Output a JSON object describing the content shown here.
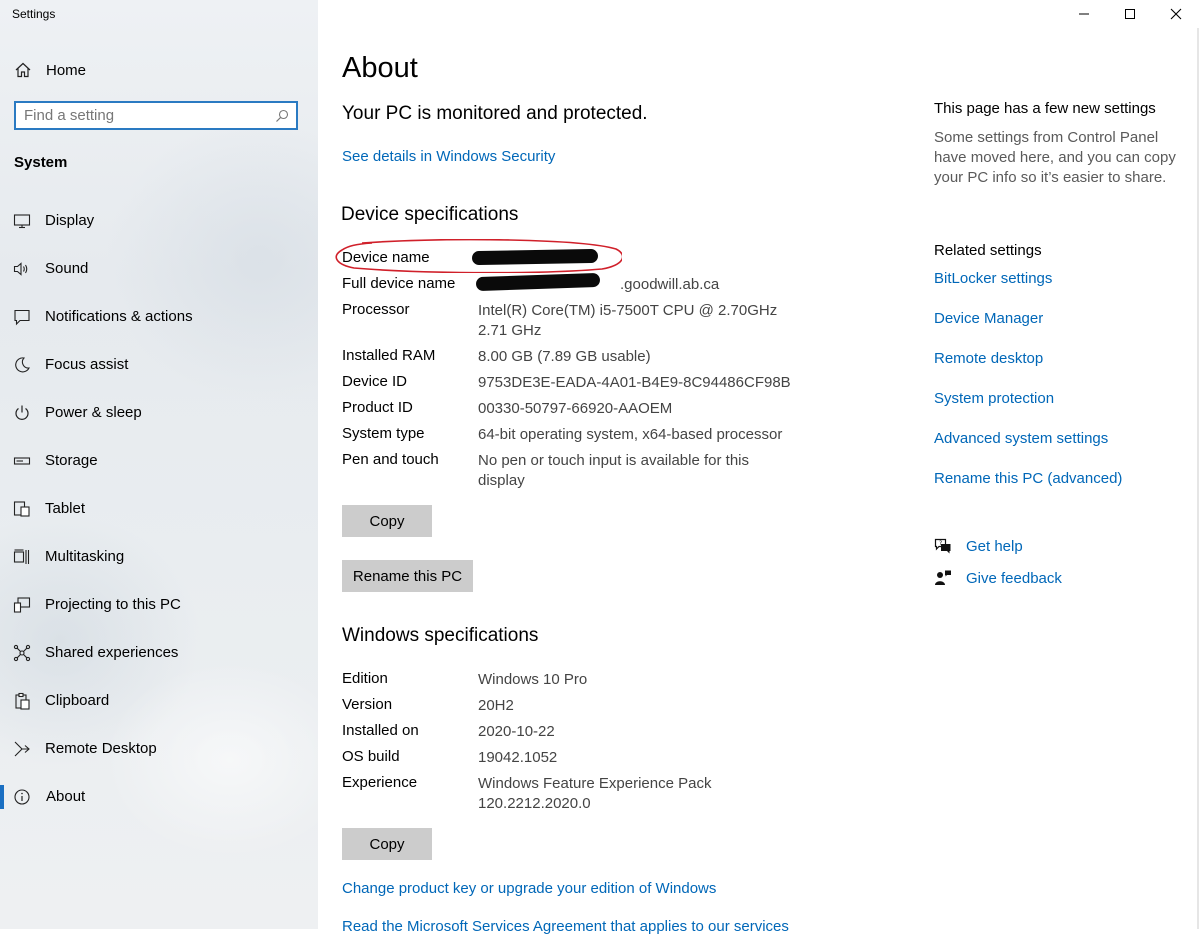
{
  "app": {
    "title": "Settings"
  },
  "window_controls": [
    "minimize",
    "maximize",
    "close"
  ],
  "sidebar": {
    "home_label": "Home",
    "search_placeholder": "Find a setting",
    "section_title": "System",
    "items": [
      {
        "label": "Display",
        "icon": "display-icon"
      },
      {
        "label": "Sound",
        "icon": "sound-icon"
      },
      {
        "label": "Notifications & actions",
        "icon": "notifications-icon"
      },
      {
        "label": "Focus assist",
        "icon": "focus-assist-icon"
      },
      {
        "label": "Power & sleep",
        "icon": "power-icon"
      },
      {
        "label": "Storage",
        "icon": "storage-icon"
      },
      {
        "label": "Tablet",
        "icon": "tablet-icon"
      },
      {
        "label": "Multitasking",
        "icon": "multitasking-icon"
      },
      {
        "label": "Projecting to this PC",
        "icon": "projecting-icon"
      },
      {
        "label": "Shared experiences",
        "icon": "shared-experiences-icon"
      },
      {
        "label": "Clipboard",
        "icon": "clipboard-icon"
      },
      {
        "label": "Remote Desktop",
        "icon": "remote-desktop-icon"
      },
      {
        "label": "About",
        "icon": "about-icon",
        "active": true
      }
    ]
  },
  "main": {
    "title": "About",
    "protected_text": "Your PC is monitored and protected.",
    "security_link": "See details in Windows Security",
    "device_spec_title": "Device specifications",
    "device_specs": [
      {
        "key": "Device name",
        "value": ""
      },
      {
        "key": "Full device name",
        "value": ".goodwill.ab.ca"
      },
      {
        "key": "Processor",
        "value": "Intel(R) Core(TM) i5-7500T CPU @ 2.70GHz   2.71 GHz"
      },
      {
        "key": "Installed RAM",
        "value": "8.00 GB (7.89 GB usable)"
      },
      {
        "key": "Device ID",
        "value": "9753DE3E-EADA-4A01-B4E9-8C94486CF98B"
      },
      {
        "key": "Product ID",
        "value": "00330-50797-66920-AAOEM"
      },
      {
        "key": "System type",
        "value": "64-bit operating system, x64-based processor"
      },
      {
        "key": "Pen and touch",
        "value": "No pen or touch input is available for this display"
      }
    ],
    "copy_label": "Copy",
    "rename_label": "Rename this PC",
    "windows_spec_title": "Windows specifications",
    "windows_specs": [
      {
        "key": "Edition",
        "value": "Windows 10 Pro"
      },
      {
        "key": "Version",
        "value": "20H2"
      },
      {
        "key": "Installed on",
        "value": "2020-10-22"
      },
      {
        "key": "OS build",
        "value": "19042.1052"
      },
      {
        "key": "Experience",
        "value": "Windows Feature Experience Pack 120.2212.2020.0"
      }
    ],
    "copy2_label": "Copy",
    "product_key_link": "Change product key or upgrade your edition of Windows",
    "msa_link": "Read the Microsoft Services Agreement that applies to our services"
  },
  "right": {
    "note_title": "This page has a few new settings",
    "note_body": "Some settings from Control Panel have moved here, and you can copy your PC info so it’s easier to share.",
    "related_title": "Related settings",
    "related_links": [
      "BitLocker settings",
      "Device Manager",
      "Remote desktop",
      "System protection",
      "Advanced system settings",
      "Rename this PC (advanced)"
    ],
    "get_help": "Get help",
    "give_feedback": "Give feedback"
  },
  "colors": {
    "accent": "#0067b8",
    "annotation": "#d0202a",
    "button": "#cccccc"
  }
}
